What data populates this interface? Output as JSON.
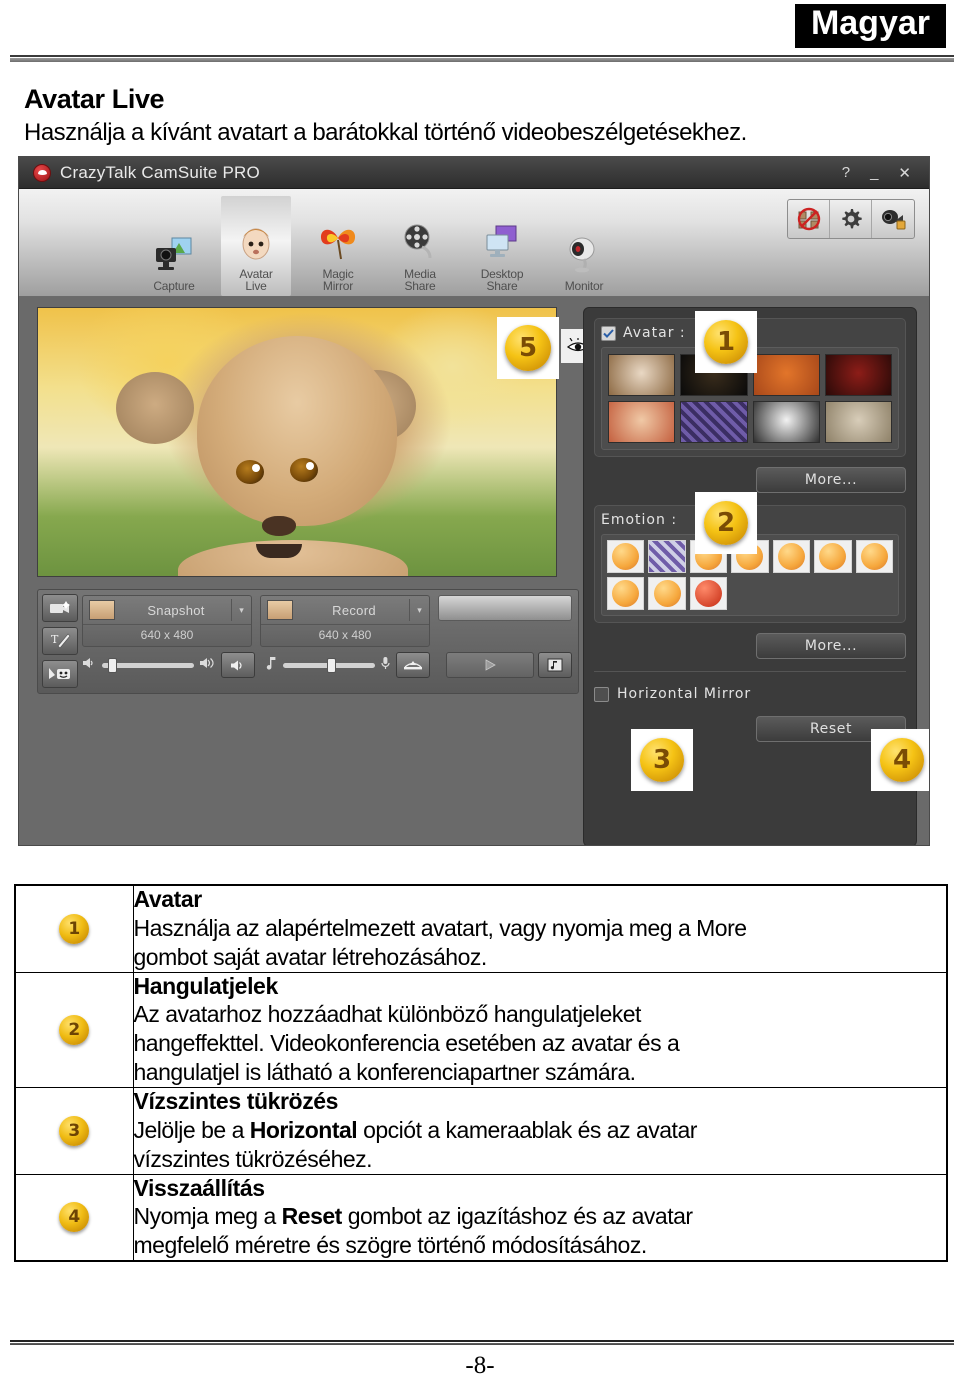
{
  "document": {
    "language_tag": "Magyar",
    "section_title": "Avatar Live",
    "section_subtitle": "Használja a kívánt avatart a barátokkal történő videobeszélgetésekhez.",
    "page_number": "-8-"
  },
  "app": {
    "title": "CrazyTalk CamSuite PRO",
    "window_controls": {
      "help": "?",
      "minimize": "_",
      "close": "✕"
    },
    "ribbon": {
      "items": [
        {
          "label_line1": "Capture",
          "label_line2": "",
          "icon": "camera-photo-icon",
          "active": false
        },
        {
          "label_line1": "Avatar",
          "label_line2": "Live",
          "icon": "baby-face-icon",
          "active": true
        },
        {
          "label_line1": "Magic",
          "label_line2": "Mirror",
          "icon": "mask-icon",
          "active": false
        },
        {
          "label_line1": "Media",
          "label_line2": "Share",
          "icon": "film-reel-icon",
          "active": false
        },
        {
          "label_line1": "Desktop",
          "label_line2": "Share",
          "icon": "monitor-share-icon",
          "active": false
        },
        {
          "label_line1": "Monitor",
          "label_line2": "",
          "icon": "webcam-icon",
          "active": false
        }
      ],
      "right_buttons": [
        {
          "icon": "no-video-icon"
        },
        {
          "icon": "gear-icon"
        },
        {
          "icon": "camera-settings-icon"
        }
      ]
    },
    "preview": {
      "image_alt": "lion-cub-photo",
      "eye_toggle_icon": "eye-icon",
      "badge": "5"
    },
    "controls": {
      "side_buttons": [
        {
          "icon": "video-effect-icon"
        },
        {
          "icon": "text-tool-icon"
        },
        {
          "icon": "sticker-tool-icon"
        }
      ],
      "snapshot": {
        "label": "Snapshot",
        "resolution": "640 x 480",
        "caret": "▾"
      },
      "record": {
        "label": "Record",
        "resolution": "640 x 480",
        "caret": "▾"
      },
      "speaker_icon": "speaker-icon",
      "speaker_loud_icon": "speaker-loud-icon",
      "mute_button_icon": "speaker-button-icon",
      "music_icon": "music-note-icon",
      "mic_icon": "microphone-icon",
      "voice_button_icon": "voice-changer-icon",
      "play_icon": "play-icon",
      "music_button_icon": "music-button-icon"
    },
    "right_panel": {
      "avatar_group": {
        "checkbox_checked": true,
        "label": "Avatar :",
        "badge": "1",
        "thumbnails": [
          {
            "name": "boy-avatar",
            "c1": "#e9d8c4",
            "c2": "#8d6a44"
          },
          {
            "name": "dark-knight-avatar",
            "c1": "#241c12",
            "c2": "#0a0a0a"
          },
          {
            "name": "ogre-avatar",
            "c1": "#e2752a",
            "c2": "#a8481a"
          },
          {
            "name": "pirate-avatar",
            "c1": "#8d1d18",
            "c2": "#2a0a08"
          },
          {
            "name": "doll-avatar",
            "c1": "#f0c9a6",
            "c2": "#c4603f"
          },
          {
            "name": "pattern-avatar",
            "c1": "#6f5ca8",
            "c2": "#3b2e63"
          },
          {
            "name": "panda-avatar",
            "c1": "#f2f2f2",
            "c2": "#303030"
          },
          {
            "name": "statue-avatar",
            "c1": "#d8cdb9",
            "c2": "#8e8168"
          }
        ],
        "more_label": "More..."
      },
      "emotion_group": {
        "label": "Emotion :",
        "badge": "2",
        "emoticons": [
          "angry-wink-emoticon",
          "pattern-emoticon",
          "sleepy-emoticon",
          "shout-emoticon",
          "whistle-emoticon",
          "surprised-emoticon",
          "crying-emoticon",
          "smile-emoticon",
          "laugh-emoticon",
          "devil-emoticon"
        ],
        "more_label": "More..."
      },
      "horizontal_mirror": {
        "label": "Horizontal Mirror",
        "checked": false,
        "badge": "3"
      },
      "reset_button": {
        "label": "Reset",
        "badge": "4"
      }
    }
  },
  "explanations": [
    {
      "number": "1",
      "title": "Avatar",
      "lines": [
        "Használja az alapértelmezett avatart, vagy nyomja meg a More",
        "gombot saját avatar létrehozásához."
      ]
    },
    {
      "number": "2",
      "title": "Hangulatjelek",
      "lines": [
        "Az avatarhoz hozzáadhat különböző hangulatjeleket",
        "hangeffekttel. Videokonferencia esetében az avatar és a",
        "hangulatjel is látható a konferenciapartner számára."
      ]
    },
    {
      "number": "3",
      "title": "Vízszintes tükrözés",
      "lines_rich": [
        [
          {
            "t": "Jelölje be a "
          },
          {
            "t": "Horizontal",
            "b": true
          },
          {
            "t": " opciót a kameraablak és az avatar"
          }
        ],
        [
          {
            "t": "vízszintes tükrözéséhez."
          }
        ]
      ]
    },
    {
      "number": "4",
      "title": "Visszaállítás",
      "lines_rich": [
        [
          {
            "t": "Nyomja meg a "
          },
          {
            "t": "Reset",
            "b": true
          },
          {
            "t": " gombot az igazításhoz és az avatar"
          }
        ],
        [
          {
            "t": "megfelelő méretre és szögre történő módosításához."
          }
        ]
      ]
    }
  ]
}
